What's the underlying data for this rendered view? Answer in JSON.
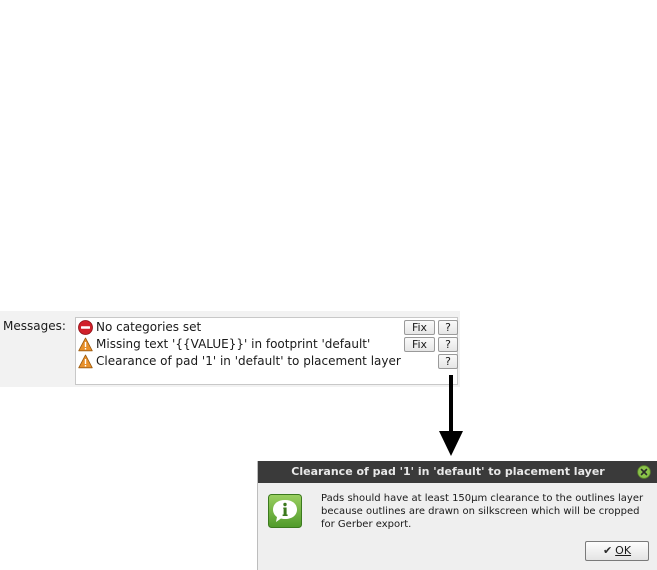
{
  "messages": {
    "label": "Messages:",
    "items": [
      {
        "severity": "error",
        "icon": "error-icon",
        "text": "No categories set",
        "fix_label": "Fix",
        "help_label": "?"
      },
      {
        "severity": "warning",
        "icon": "warning-icon",
        "text": "Missing text '{{VALUE}}' in footprint 'default'",
        "fix_label": "Fix",
        "help_label": "?"
      },
      {
        "severity": "warning",
        "icon": "warning-icon",
        "text": "Clearance of pad '1' in 'default' to placement layer",
        "help_label": "?"
      }
    ]
  },
  "dialog": {
    "title": "Clearance of pad '1' in 'default' to placement layer",
    "icon": "info-icon",
    "message": "Pads should have at least 150µm clearance to the outlines layer because outlines are drawn on silkscreen which will be cropped for Gerber export.",
    "ok_label": "OK",
    "ok_icon": "check-icon"
  },
  "colors": {
    "error": "#d0202a",
    "warning": "#e8902a",
    "info_green": "#6db33f",
    "titlebar": "#3a3a3a",
    "close_green": "#8bc34a"
  }
}
